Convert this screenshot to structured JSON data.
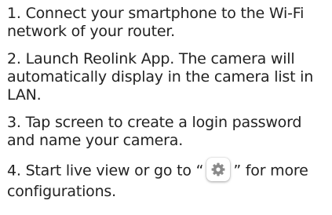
{
  "steps": [
    {
      "text": "1. Connect your smartphone to the Wi-Fi network of your router."
    },
    {
      "text": "2. Launch Reolink App. The camera will automatically display in the camera list in LAN."
    },
    {
      "text": "3. Tap screen to create a login password and name your camera."
    },
    {
      "text_before": "4. Start live view or go to “",
      "icon": "settings-gear-icon",
      "text_after": "” for more configurations."
    }
  ],
  "colors": {
    "text": "#222222",
    "icon": "#8a8a8a",
    "background": "#ffffff"
  }
}
